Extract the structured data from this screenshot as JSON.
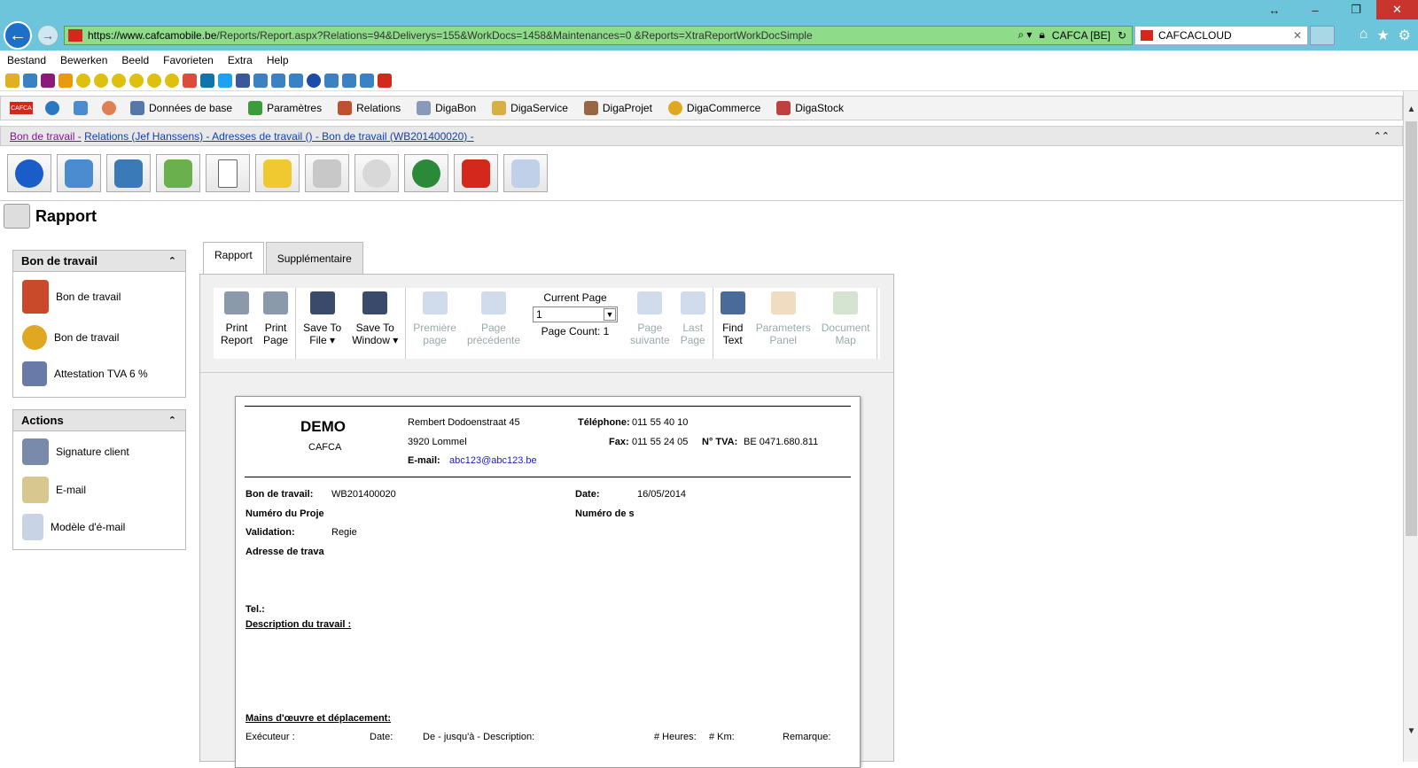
{
  "browser": {
    "url_host": "https://www.cafcamobile.be",
    "url_rest": "/Reports/Report.aspx?Relations=94&Deliverys=155&WorkDocs=1458&Maintenances=0 &Reports=XtraReportWorkDocSimple",
    "site_identity": "CAFCA [BE]",
    "tab_title": "CAFCACLOUD",
    "tab_close": "✕"
  },
  "menu": [
    "Bestand",
    "Bewerken",
    "Beeld",
    "Favorieten",
    "Extra",
    "Help"
  ],
  "app_toolbar": [
    "Données de base",
    "Paramètres",
    "Relations",
    "DigaBon",
    "DigaService",
    "DigaProjet",
    "DigaCommerce",
    "DigaStock"
  ],
  "breadcrumb": {
    "first": "Bon de travail -",
    "rest": "Relations (Jef Hanssens) - Adresses de travail () - Bon de travail (WB201400020) -"
  },
  "page_title": "Rapport",
  "panel_bon": {
    "title": "Bon de travail",
    "items": [
      "Bon de travail",
      "Bon de travail",
      "Attestation TVA 6 %"
    ]
  },
  "panel_actions": {
    "title": "Actions",
    "items": [
      "Signature client",
      "E-mail",
      "Modèle d'é-mail"
    ]
  },
  "tabs": [
    "Rapport",
    "Supplémentaire"
  ],
  "report_toolbar": {
    "print_report": [
      "Print",
      "Report"
    ],
    "print_page": [
      "Print",
      "Page"
    ],
    "save_file": [
      "Save To",
      "File ▾"
    ],
    "save_window": [
      "Save To",
      "Window ▾"
    ],
    "first_page": [
      "Première",
      "page"
    ],
    "prev_page": [
      "Page",
      "précédente"
    ],
    "current_page_label": "Current Page",
    "current_page_value": "1",
    "page_count": "Page Count: 1",
    "next_page": [
      "Page",
      "suivante"
    ],
    "last_page": [
      "Last",
      "Page"
    ],
    "find_text": [
      "Find",
      "Text"
    ],
    "parameters_panel": [
      "Parameters",
      "Panel"
    ],
    "document_map": [
      "Document",
      "Map"
    ]
  },
  "report": {
    "company": "DEMO",
    "company_sub": "CAFCA",
    "street": "Rembert Dodoenstraat 45",
    "city": "3920 Lommel",
    "email_label": "E-mail:",
    "email": "abc123@abc123.be",
    "tel_label": "Téléphone:",
    "tel": "011 55 40 10",
    "fax_label": "Fax:",
    "fax": "011 55 24 05",
    "vat_label": "N° TVA:",
    "vat": "BE 0471.680.811",
    "bon_label": "Bon de travail:",
    "bon": "WB201400020",
    "date_label": "Date:",
    "date": "16/05/2014",
    "projet_label": "Numéro du Proje",
    "serie_label": "Numéro de s",
    "validation_label": "Validation:",
    "validation": "Regie",
    "adresse_label": "Adresse de trava",
    "tel2_label": "Tel.:",
    "desc_label": "Description du travail :",
    "mains_label": "Mains d'œuvre et déplacement:",
    "cols": [
      "Exécuteur :",
      "Date:",
      "De - jusqu'à - Description:",
      "# Heures:",
      "# Km:",
      "Remarque:"
    ]
  }
}
